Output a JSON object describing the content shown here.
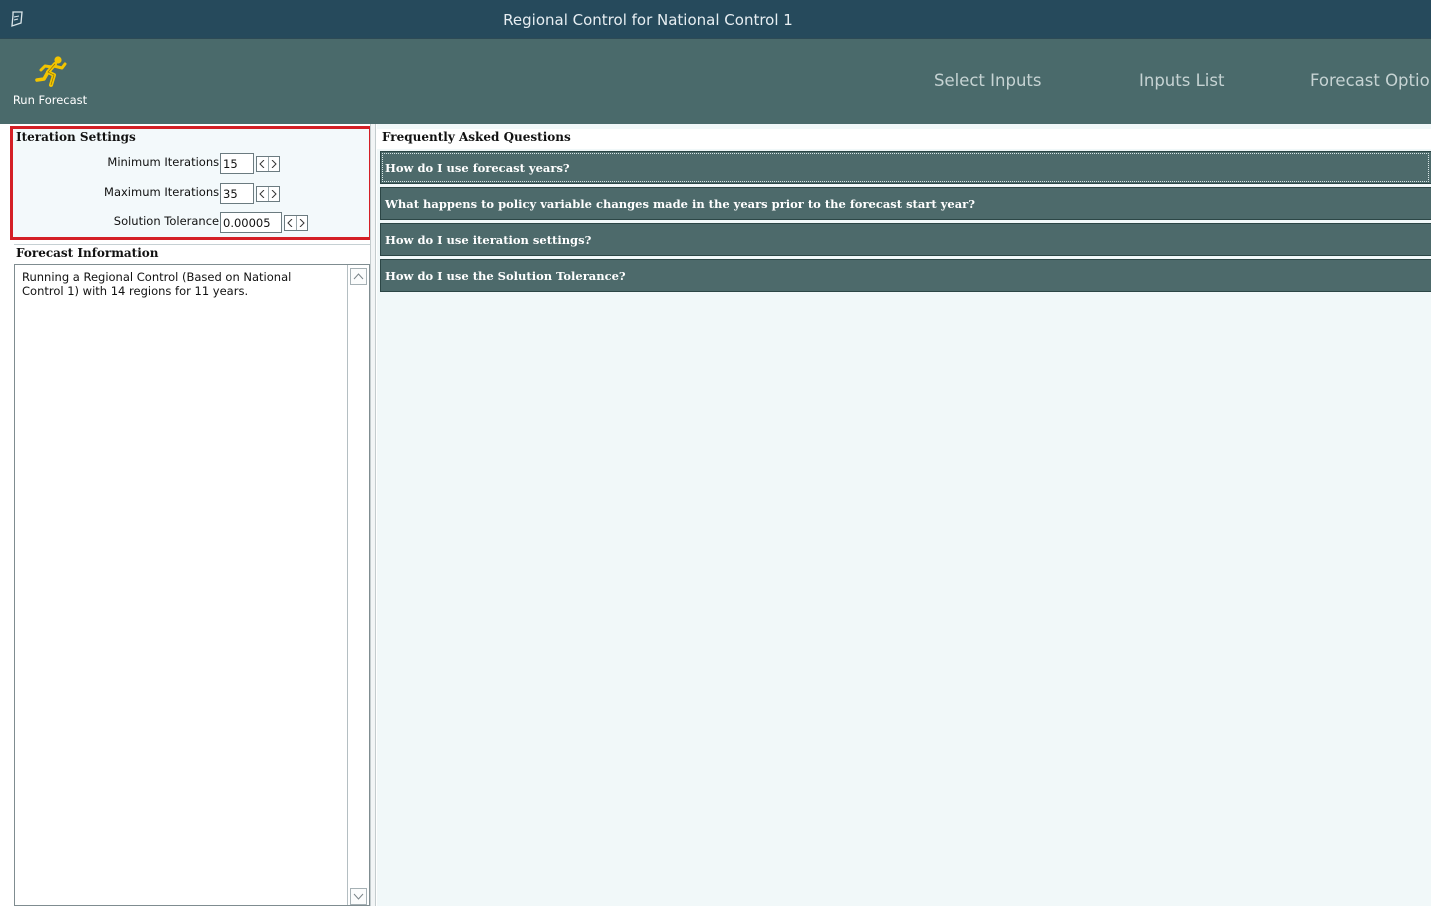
{
  "window": {
    "title": "Regional Control for National Control 1"
  },
  "toolbar": {
    "run_forecast_label": "Run Forecast",
    "nav": [
      "Select Inputs",
      "Inputs List",
      "Forecast Option"
    ]
  },
  "iteration_settings": {
    "header": "Iteration Settings",
    "min_label": "Minimum Iterations:",
    "min_value": "15",
    "max_label": "Maximum Iterations:",
    "max_value": "35",
    "tol_label": "Solution Tolerance:",
    "tol_value": "0.00005"
  },
  "forecast_info": {
    "header": "Forecast Information",
    "text": "Running a Regional Control (Based on National Control 1) with 14 regions for 11 years."
  },
  "faq": {
    "header": "Frequently Asked Questions",
    "items": [
      "How do I use forecast years?",
      "What happens to policy variable changes made in the years prior to the forecast start year?",
      "How do I use iteration settings?",
      "How do I use the Solution Tolerance?"
    ]
  },
  "colors": {
    "titlebar": "#264a5c",
    "ribbon": "#4a6a6b",
    "faq_item": "#4d6a6b",
    "highlight_border": "#d41f26",
    "run_icon": "#f2c400"
  },
  "icons": {
    "app": "app-icon",
    "run": "running-man-icon"
  }
}
